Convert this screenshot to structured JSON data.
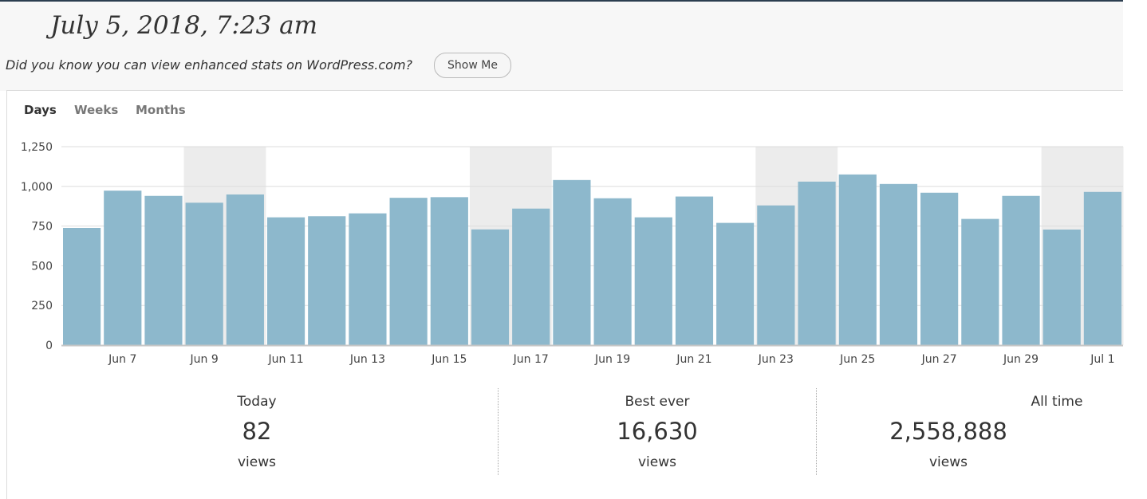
{
  "header": {
    "date_title": "July 5, 2018, 7:23 am",
    "promo_text": "Did you know you can view enhanced stats on WordPress.com?",
    "show_me_label": "Show Me"
  },
  "tabs": [
    {
      "label": "Days",
      "active": true
    },
    {
      "label": "Weeks",
      "active": false
    },
    {
      "label": "Months",
      "active": false
    }
  ],
  "chart_data": {
    "type": "bar",
    "categories": [
      "Jun 6",
      "Jun 7",
      "Jun 8",
      "Jun 9",
      "Jun 10",
      "Jun 11",
      "Jun 12",
      "Jun 13",
      "Jun 14",
      "Jun 15",
      "Jun 16",
      "Jun 17",
      "Jun 18",
      "Jun 19",
      "Jun 20",
      "Jun 21",
      "Jun 22",
      "Jun 23",
      "Jun 24",
      "Jun 25",
      "Jun 26",
      "Jun 27",
      "Jun 28",
      "Jun 29",
      "Jun 30",
      "Jul 1"
    ],
    "values": [
      738,
      973,
      940,
      897,
      949,
      805,
      812,
      830,
      928,
      932,
      729,
      860,
      1040,
      925,
      805,
      936,
      770,
      880,
      1030,
      1075,
      1015,
      960,
      795,
      940,
      728,
      965
    ],
    "weekend_categories": [
      "Jun 9",
      "Jun 10",
      "Jun 16",
      "Jun 17",
      "Jun 23",
      "Jun 24",
      "Jun 30",
      "Jul 1"
    ],
    "x_tick_labels": [
      "Jun 7",
      "Jun 9",
      "Jun 11",
      "Jun 13",
      "Jun 15",
      "Jun 17",
      "Jun 19",
      "Jun 21",
      "Jun 23",
      "Jun 25",
      "Jun 27",
      "Jun 29",
      "Jul 1"
    ],
    "y_ticks": [
      0,
      250,
      500,
      750,
      1000,
      1250
    ],
    "y_tick_labels": [
      "0",
      "250",
      "500",
      "750",
      "1,000",
      "1,250"
    ],
    "ylim": [
      0,
      1250
    ],
    "grid": true,
    "title": "",
    "xlabel": "",
    "ylabel": "",
    "colors": {
      "bar": "#8db8cc",
      "weekend_band": "#ececec",
      "grid": "#dddddd",
      "axis": "#c6c6c6"
    }
  },
  "summary": [
    {
      "label": "Today",
      "value": "82",
      "unit": "views"
    },
    {
      "label": "Best ever",
      "value": "16,630",
      "unit": "views"
    },
    {
      "label": "All time",
      "value": "2,558,888",
      "unit": "views"
    }
  ]
}
